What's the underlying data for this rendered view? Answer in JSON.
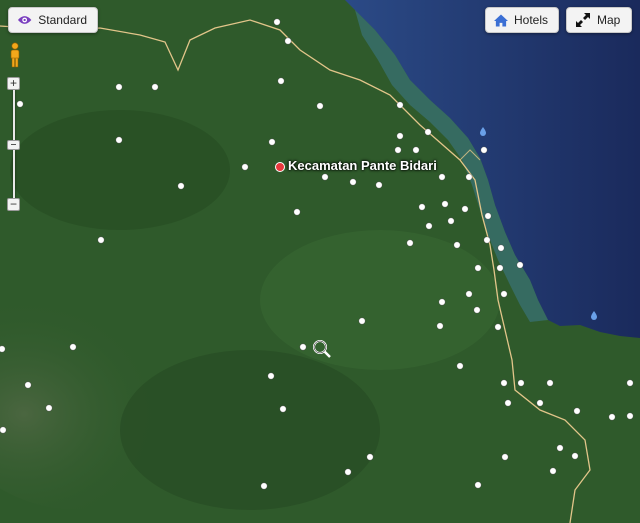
{
  "controls": {
    "standard_label": "Standard",
    "hotels_label": "Hotels",
    "map_label": "Map",
    "zoom_in": "+",
    "zoom_out": "−",
    "icons": {
      "standard": "eye-icon",
      "hotels": "house-icon",
      "map": "expand-arrows-icon",
      "pegman": "street-view-person-icon"
    }
  },
  "place": {
    "name": "Kecamatan Pante Bidari",
    "marker_color": "#e8383d"
  },
  "colors": {
    "sea": "#1b2d5e",
    "land": "#2f5a2b",
    "road": "#e2c58a",
    "poi": "#ffffff"
  }
}
